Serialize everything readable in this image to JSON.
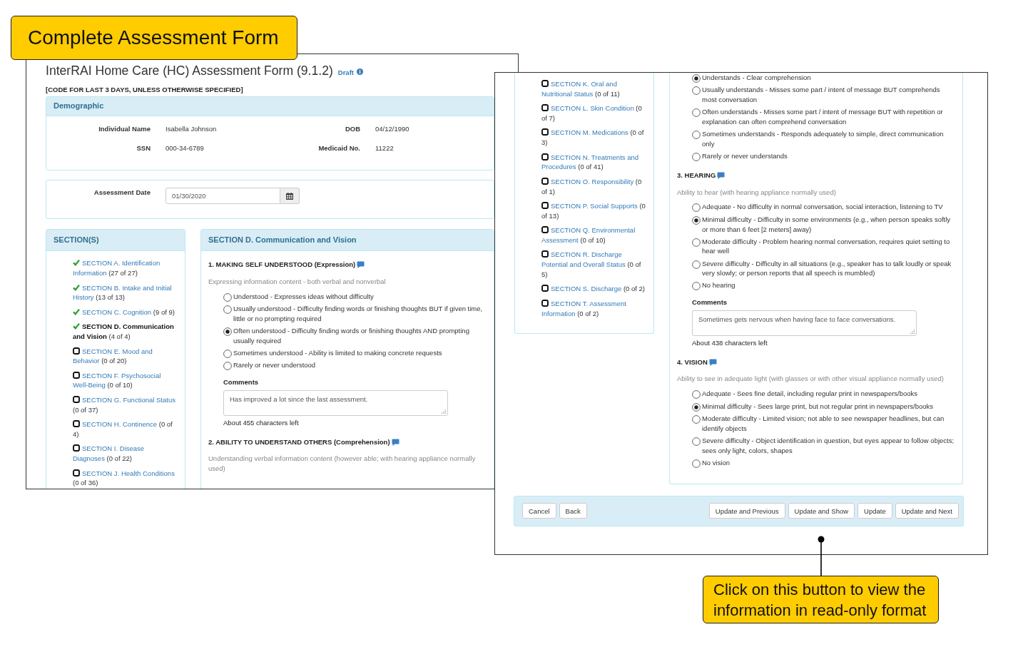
{
  "title_callout": {
    "text": "Complete Assessment Form"
  },
  "form_window": {
    "title": "InterRAI Home Care (HC) Assessment Form (9.1.2)",
    "status": "Draft",
    "instruction": "[CODE FOR LAST 3 DAYS, UNLESS OTHERWISE SPECIFIED]",
    "demographic": {
      "heading": "Demographic",
      "fields": [
        {
          "label": "Individual Name",
          "value": "Isabella Johnson"
        },
        {
          "label": "DOB",
          "value": "04/12/1990"
        },
        {
          "label": "SSN",
          "value": "000-34-6789"
        },
        {
          "label": "Medicaid No.",
          "value": "11222"
        }
      ]
    },
    "assessment_date": {
      "label": "Assessment Date",
      "value": "01/30/2020"
    },
    "sections": {
      "heading": "SECTION(S)",
      "items": [
        {
          "title": "SECTION A. Identification Information",
          "count": "(27 of 27)",
          "complete": true,
          "selected": false
        },
        {
          "title": "SECTION B. Intake and Initial History",
          "count": "(13 of 13)",
          "complete": true,
          "selected": false
        },
        {
          "title": "SECTION C. Cognition",
          "count": "(9 of 9)",
          "complete": true,
          "selected": false
        },
        {
          "title": "SECTION D. Communication and Vision",
          "count": "(4 of 4)",
          "complete": true,
          "selected": true
        },
        {
          "title": "SECTION E. Mood and Behavior",
          "count": "(0 of 20)",
          "complete": false,
          "selected": false
        },
        {
          "title": "SECTION F. Psychosocial Well-Being",
          "count": "(0 of 10)",
          "complete": false,
          "selected": false
        },
        {
          "title": "SECTION G. Functional Status",
          "count": "(0 of 37)",
          "complete": false,
          "selected": false
        },
        {
          "title": "SECTION H. Continence",
          "count": "(0 of 4)",
          "complete": false,
          "selected": false
        },
        {
          "title": "SECTION I. Disease Diagnoses",
          "count": "(0 of 22)",
          "complete": false,
          "selected": false
        },
        {
          "title": "SECTION J. Health Conditions",
          "count": "(0 of 36)",
          "complete": false,
          "selected": false
        }
      ]
    },
    "section": {
      "heading": "SECTION D. Communication and Vision",
      "questions": [
        {
          "title": "1. MAKING SELF UNDERSTOOD (Expression)",
          "hint": "Expressing information content - both verbal and nonverbal",
          "options": [
            {
              "label": "Understood - Expresses ideas without difficulty",
              "selected": false
            },
            {
              "label": "Usually understood - Difficulty finding words or finishing thoughts BUT if given time, little or no prompting required",
              "selected": false
            },
            {
              "label": "Often understood - Difficulty finding words or finishing thoughts AND prompting usually required",
              "selected": true
            },
            {
              "label": "Sometimes understood - Ability is limited to making concrete requests",
              "selected": false
            },
            {
              "label": "Rarely or never understood",
              "selected": false
            }
          ],
          "comments": {
            "label": "Comments",
            "value": "Has improved a lot since the last assessment.",
            "remaining": "About 455 characters left"
          }
        },
        {
          "title": "2. ABILITY TO UNDERSTAND OTHERS (Comprehension)",
          "hint": "Understanding verbal information content (however able; with hearing appliance normally used)"
        }
      ]
    }
  },
  "scrolled_window": {
    "sections": {
      "items": [
        {
          "title": "SECTION K. Oral and Nutritional Status",
          "count": "(0 of 11)",
          "complete": false,
          "selected": false
        },
        {
          "title": "SECTION L. Skin Condition",
          "count": "(0 of 7)",
          "complete": false,
          "selected": false
        },
        {
          "title": "SECTION M. Medications",
          "count": "(0 of 3)",
          "complete": false,
          "selected": false
        },
        {
          "title": "SECTION N. Treatments and Procedures",
          "count": "(0 of 41)",
          "complete": false,
          "selected": false
        },
        {
          "title": "SECTION O. Responsibility",
          "count": "(0 of 1)",
          "complete": false,
          "selected": false
        },
        {
          "title": "SECTION P. Social Supports",
          "count": "(0 of 13)",
          "complete": false,
          "selected": false
        },
        {
          "title": "SECTION Q. Environmental Assessment",
          "count": "(0 of 10)",
          "complete": false,
          "selected": false
        },
        {
          "title": "SECTION R. Discharge Potential and Overall Status",
          "count": "(0 of 5)",
          "complete": false,
          "selected": false
        },
        {
          "title": "SECTION S. Discharge",
          "count": "(0 of 2)",
          "complete": false,
          "selected": false
        },
        {
          "title": "SECTION T. Assessment Information",
          "count": "(0 of 2)",
          "complete": false,
          "selected": false
        }
      ]
    },
    "section": {
      "questions": [
        {
          "options": [
            {
              "label": "Understands - Clear comprehension",
              "selected": true
            },
            {
              "label": "Usually understands - Misses some part / intent of message BUT comprehends most conversation",
              "selected": false
            },
            {
              "label": "Often understands - Misses some part / intent of message BUT with repetition or explanation can often comprehend conversation",
              "selected": false
            },
            {
              "label": "Sometimes understands - Responds adequately to simple, direct communication only",
              "selected": false
            },
            {
              "label": "Rarely or never understands",
              "selected": false
            }
          ]
        },
        {
          "title": "3. HEARING",
          "hint": "Ability to hear (with hearing appliance normally used)",
          "options": [
            {
              "label": "Adequate - No difficulty in normal conversation, social interaction, listening to TV",
              "selected": false
            },
            {
              "label": "Minimal difficulty - Difficulty in some environments (e.g., when person speaks softly or more than 6 feet [2 meters] away)",
              "selected": true
            },
            {
              "label": "Moderate difficulty - Problem hearing normal conversation, requires quiet setting to hear well",
              "selected": false
            },
            {
              "label": "Severe difficulty - Difficulty in all situations (e.g., speaker has to talk loudly or speak very slowly; or person reports that all speech is mumbled)",
              "selected": false
            },
            {
              "label": "No hearing",
              "selected": false
            }
          ],
          "comments": {
            "label": "Comments",
            "value": "Sometimes gets nervous when having face to face conversations.",
            "remaining": "About 438 characters left"
          }
        },
        {
          "title": "4. VISION",
          "hint": "Ability to see in adequate light (with glasses or with other visual appliance normally used)",
          "options": [
            {
              "label": "Adequate - Sees fine detail, including regular print in newspapers/books",
              "selected": false
            },
            {
              "label": "Minimal difficulty - Sees large print, but not regular print in newspapers/books",
              "selected": true
            },
            {
              "label": "Moderate difficulty - Limited vision; not able to see newspaper headlines, but can identify objects",
              "selected": false
            },
            {
              "label": "Severe difficulty - Object identification in question, but eyes appear to follow objects; sees only light, colors, shapes",
              "selected": false
            },
            {
              "label": "No vision",
              "selected": false
            }
          ]
        }
      ]
    },
    "buttons_left": [
      {
        "label": "Cancel"
      },
      {
        "label": "Back"
      }
    ],
    "buttons_right": [
      {
        "label": "Update and Previous"
      },
      {
        "label": "Update and Show"
      },
      {
        "label": "Update"
      },
      {
        "label": "Update and Next"
      }
    ]
  },
  "button_callout": {
    "text": "Click on this button to view the information in read-only format"
  }
}
